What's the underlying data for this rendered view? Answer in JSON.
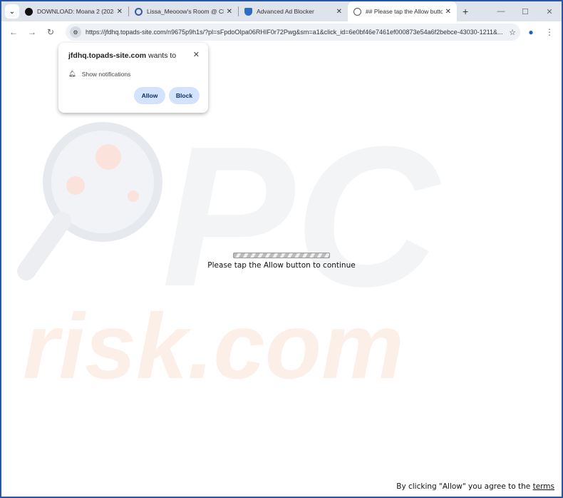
{
  "tabs": [
    {
      "title": "DOWNLOAD: Moana 2 (2024) F",
      "icon": "circle-logo-icon"
    },
    {
      "title": "Lissa_Meooow's Room @ Chat",
      "icon": "chat-logo-icon"
    },
    {
      "title": "Advanced Ad Blocker",
      "icon": "shield-icon"
    },
    {
      "title": "## Please tap the Allow button",
      "icon": "globe-icon",
      "active": true
    }
  ],
  "address": {
    "url": "https://jfdhq.topads-site.com/n9675p9h1s/?pl=sFpdoOIpa06RHIF0r72Pwg&sm=a1&click_id=6e0bf46e7461ef000873e54a6f2bebce-43030-1211&..."
  },
  "popup": {
    "site": "jfdhq.topads-site.com",
    "wants": "wants to",
    "permission": "Show notifications",
    "allow": "Allow",
    "block": "Block"
  },
  "page": {
    "message": "Please tap the Allow button to continue",
    "footer_prefix": "By clicking \"Allow\" you agree to the ",
    "footer_link": "terms",
    "progress_style": "indeterminate-striped"
  },
  "watermark": {
    "text1": "PC",
    "text2": "risk.com"
  },
  "colors": {
    "accent": "#d3e3fd",
    "frame": "#2a55a0"
  }
}
